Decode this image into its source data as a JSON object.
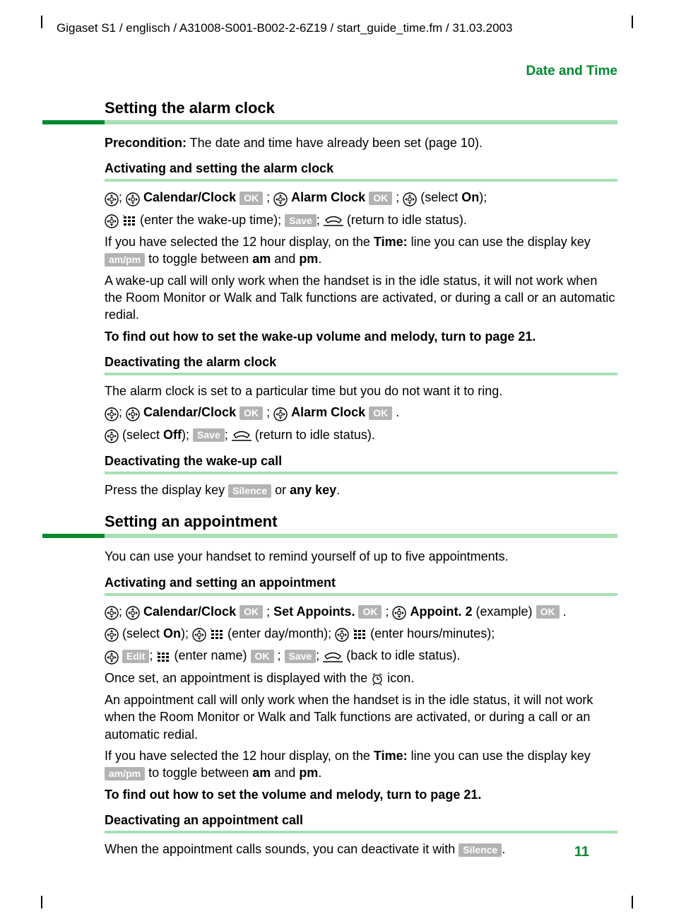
{
  "header_path": "Gigaset S1 / englisch / A31008-S001-B002-2-6Z19 / start_guide_time.fm / 31.03.2003",
  "section_label": "Date and Time",
  "page_number": "11",
  "keys": {
    "ok": "OK",
    "save": "Save",
    "ampm": "am/pm",
    "silence": "Silence",
    "edit": "Edit"
  },
  "labels": {
    "calendar_clock": "Calendar/Clock",
    "alarm_clock": "Alarm Clock",
    "set_appoints": "Set Appoints.",
    "appoint2": "Appoint. 2",
    "on": "On",
    "off": "Off",
    "am": "am",
    "pm": "pm",
    "time": "Time:",
    "any_key": "any key",
    "example": "(example)",
    "precondition": "Precondition:"
  },
  "h": {
    "setting_alarm": "Setting the alarm clock",
    "activating_alarm": "Activating and setting the alarm clock",
    "deactivating_alarm": "Deactivating the alarm clock",
    "deactivating_wakeup": "Deactivating the wake-up call",
    "setting_appointment": "Setting an appointment",
    "activating_appointment": "Activating and setting an appointment",
    "deactivating_appointment": "Deactivating an appointment call"
  },
  "txt": {
    "precondition_body": " The date and time have already been set (page 10).",
    "act1_select_on": " (select ",
    "act1_close": ");",
    "act2_enter_wakeup": " (enter the wake-up time); ",
    "act2_return": " (return to idle status).",
    "act_12h_1": "If you have selected the 12 hour display, on the ",
    "act_12h_2": " line you can use the display key ",
    "act_12h_3": " to toggle between ",
    "act_12h_and": " and ",
    "act_wakeup_note": "A wake-up call will only work when the handset is in the idle status, it will not work when the Room Monitor or Walk and Talk functions are activated, or during a call or an automatic redial.",
    "act_findout": "To find out how to set the wake-up volume and melody, turn to page 21.",
    "deact_intro": "The alarm clock is set to a particular time but you do not want it to ring.",
    "deact_select_off_1": " (select ",
    "deact_select_off_2": "); ",
    "deact_return": " (return to idle status).",
    "deact_wakeup_1": "Press the display key ",
    "deact_wakeup_2": " or ",
    "appt_intro": "You can use your handset to remind yourself of up to five appointments.",
    "appt_select_on_1": " (select ",
    "appt_select_on_2": "); ",
    "appt_enter_day": " (enter day/month); ",
    "appt_enter_hours": " (enter hours/minutes);",
    "appt_enter_name": " (enter name) ",
    "appt_back": " (back to idle status).",
    "appt_once_set": "Once set, an appointment is displayed with the ",
    "appt_icon_end": " icon.",
    "appt_note": "An appointment call will only work when the handset is in the idle status, it will not work when the Room Monitor or Walk and Talk functions are activated, or during a call or an automatic redial.",
    "appt_findout": "To find out how to set the volume and melody, turn to page 21.",
    "appt_deact_1": "When the appointment calls sounds, you can deactivate it with "
  }
}
